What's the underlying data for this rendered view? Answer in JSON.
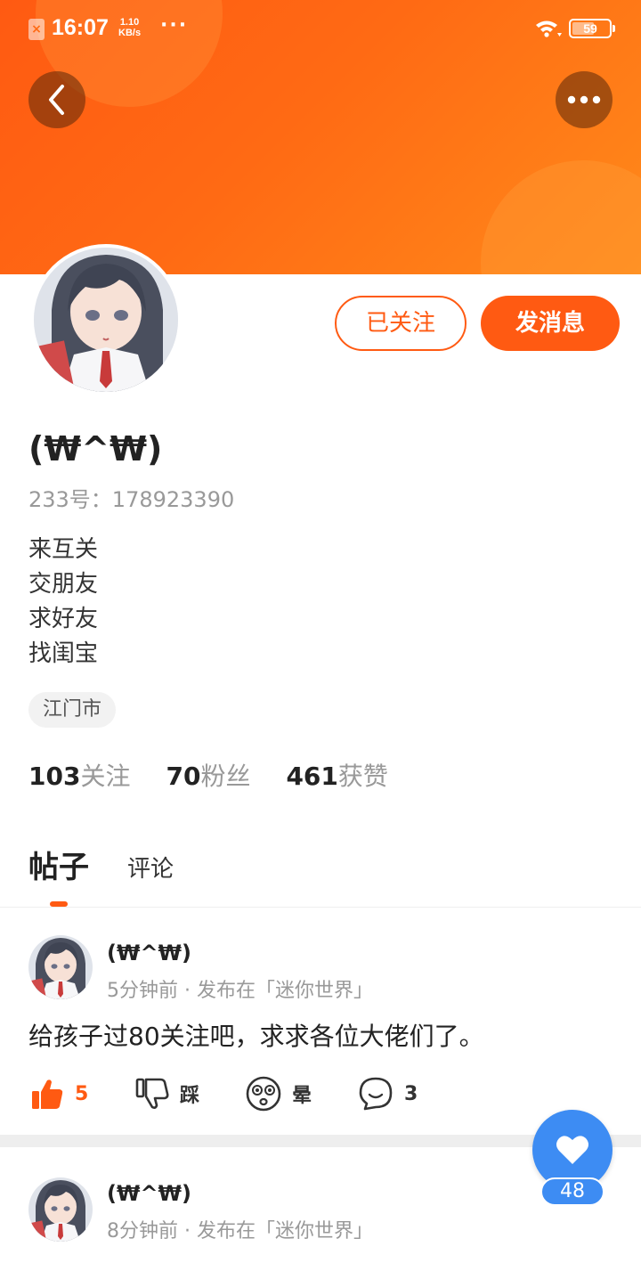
{
  "status_bar": {
    "time": "16:07",
    "net_speed_value": "1.10",
    "net_speed_unit": "KB/s",
    "more": "···",
    "battery": "59",
    "battery_level": 0.59
  },
  "profile": {
    "username": "(₩^₩)",
    "id_line": "233号：178923390",
    "bio_lines": [
      "来互关",
      "交朋友",
      "求好友",
      "找闺宝"
    ],
    "location": "江门市",
    "follow_button": "已关注",
    "message_button": "发消息",
    "stats": [
      {
        "value": "103",
        "label": "关注"
      },
      {
        "value": "70",
        "label": "粉丝"
      },
      {
        "value": "461",
        "label": "获赞"
      }
    ]
  },
  "tabs": [
    {
      "label": "帖子",
      "active": true
    },
    {
      "label": "评论",
      "active": false
    }
  ],
  "posts": [
    {
      "author": "(₩^₩)",
      "meta": "5分钟前 · 发布在「迷你世界」",
      "text": "给孩子过80关注吧，求求各位大佬们了。",
      "actions": {
        "like": "5",
        "dislike": "踩",
        "dizzy": "晕",
        "comments": "3"
      }
    },
    {
      "author": "(₩^₩)",
      "meta": "8分钟前 · 发布在「迷你世界」"
    }
  ],
  "fab": {
    "count": "48"
  },
  "colors": {
    "accent": "#ff5a12",
    "fab": "#3d8cf3",
    "muted": "#999999"
  }
}
